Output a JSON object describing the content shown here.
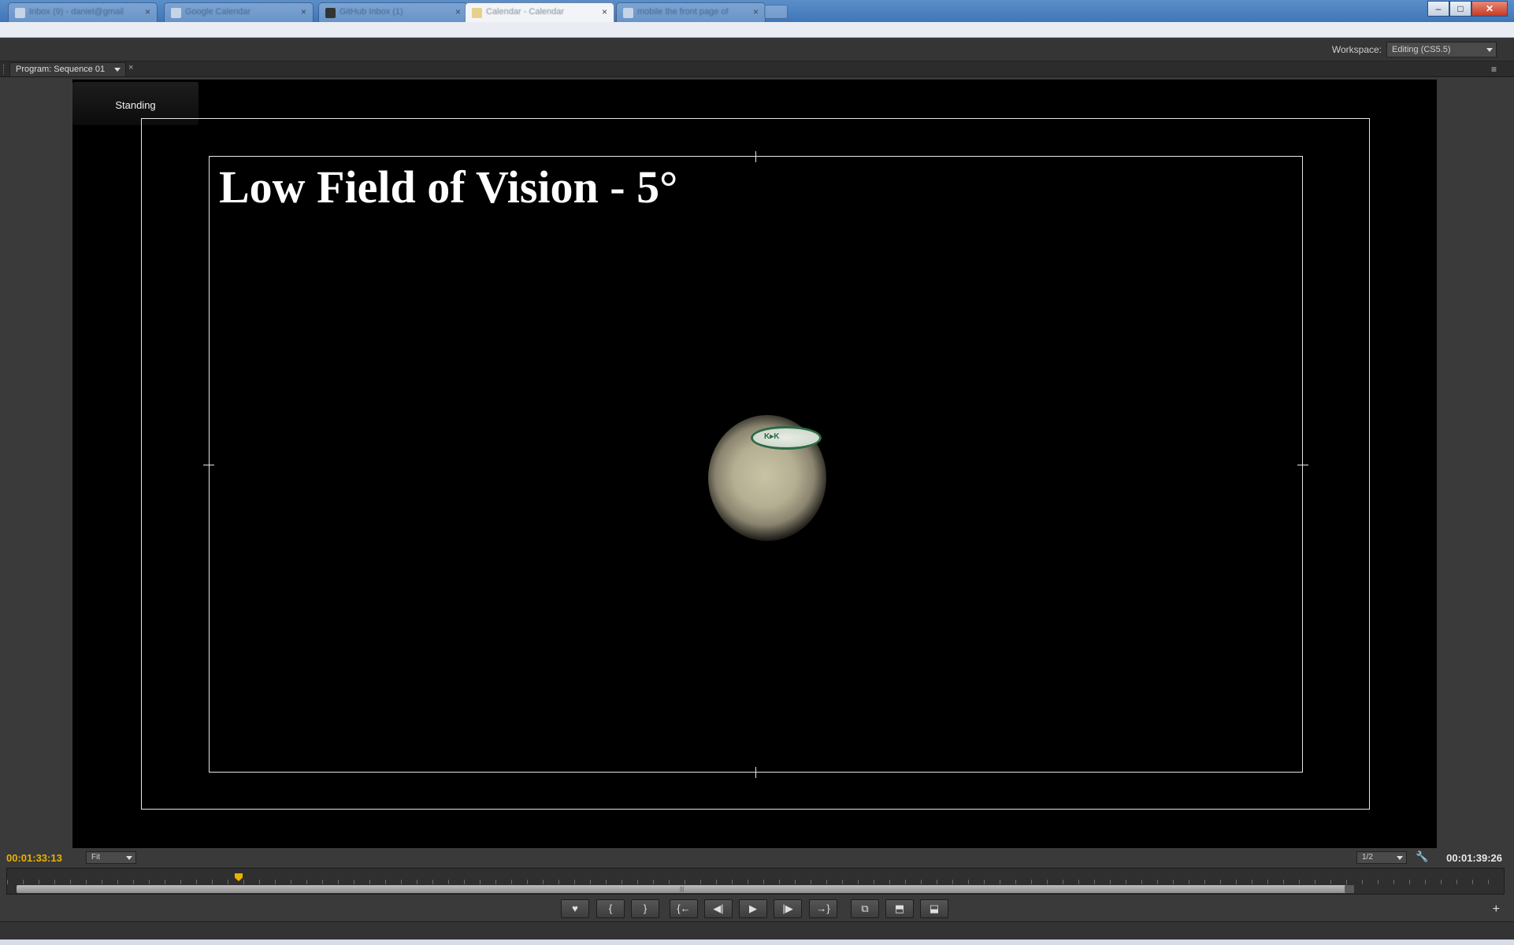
{
  "browser": {
    "tabs": [
      {
        "label": "Inbox (9) - daniel@gmail",
        "active": false
      },
      {
        "label": "Google Calendar",
        "active": false
      },
      {
        "label": "GitHub Inbox (1)",
        "active": false
      },
      {
        "label": "Calendar - Calendar",
        "active": true
      },
      {
        "label": "mobile the front page of",
        "active": false
      }
    ],
    "window_buttons": {
      "minimize": "–",
      "maximize": "□",
      "close": "✕"
    }
  },
  "workspace": {
    "label": "Workspace:",
    "selected": "Editing (CS5.5)"
  },
  "panel": {
    "tab_label": "Program: Sequence 01",
    "close": "×",
    "menu_icon": "≡"
  },
  "monitor": {
    "clip_label": "Standing",
    "overlay_title": "Low Field of Vision - 5°"
  },
  "timecode": {
    "current": "00:01:33:13",
    "duration": "00:01:39:26",
    "zoom": "Fit",
    "resolution": "1/2",
    "playhead_fraction": 0.152
  },
  "transport": {
    "buttons": [
      {
        "name": "add-marker-button",
        "glyph": "♥"
      },
      {
        "name": "mark-in-button",
        "glyph": "{"
      },
      {
        "name": "mark-out-button",
        "glyph": "}"
      },
      {
        "name": "go-to-in-button",
        "glyph": "{←"
      },
      {
        "name": "step-back-button",
        "glyph": "◀|"
      },
      {
        "name": "play-button",
        "glyph": "▶"
      },
      {
        "name": "step-forward-button",
        "glyph": "|▶"
      },
      {
        "name": "go-to-out-button",
        "glyph": "→}"
      },
      {
        "name": "export-frame-button",
        "glyph": "⧉"
      },
      {
        "name": "lift-button",
        "glyph": "⬒"
      },
      {
        "name": "extract-button",
        "glyph": "⬓"
      }
    ],
    "add_glyph": "+"
  },
  "colors": {
    "timecode_accent": "#e8b200",
    "panel_bg": "#3a3a3a",
    "video_bg": "#000000"
  }
}
